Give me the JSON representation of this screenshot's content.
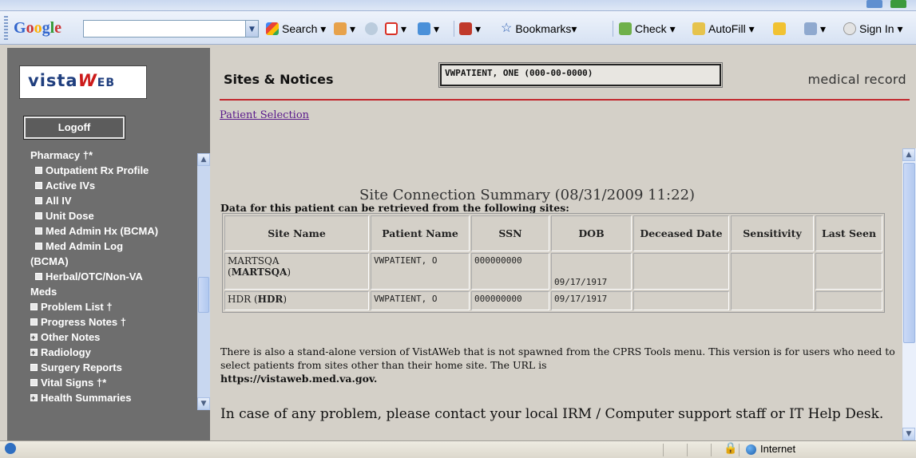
{
  "toolbar": {
    "search_value": "",
    "search_label": "Search",
    "bookmarks_label": "Bookmarks",
    "check_label": "Check",
    "autofill_label": "AutoFill",
    "signin_label": "Sign In"
  },
  "sidebar": {
    "logoff_label": "Logoff",
    "items": [
      {
        "label": "Pharmacy †*",
        "icon": "none"
      },
      {
        "label": "Outpatient Rx Profile",
        "icon": "square"
      },
      {
        "label": "Active IVs",
        "icon": "square"
      },
      {
        "label": "All IV",
        "icon": "square"
      },
      {
        "label": "Unit Dose",
        "icon": "square"
      },
      {
        "label": "Med Admin Hx (BCMA)",
        "icon": "square"
      },
      {
        "label": "Med Admin Log",
        "icon": "square"
      },
      {
        "label": "(BCMA)",
        "icon": "none"
      },
      {
        "label": "Herbal/OTC/Non-VA",
        "icon": "square"
      },
      {
        "label": "Meds",
        "icon": "none"
      },
      {
        "label": "Problem List †",
        "icon": "square"
      },
      {
        "label": "Progress Notes †",
        "icon": "square"
      },
      {
        "label": "Other Notes",
        "icon": "plus"
      },
      {
        "label": "Radiology",
        "icon": "plus"
      },
      {
        "label": "Surgery Reports",
        "icon": "square"
      },
      {
        "label": "Vital Signs †*",
        "icon": "square"
      },
      {
        "label": "Health Summaries",
        "icon": "plus"
      }
    ]
  },
  "header": {
    "title": "Sites & Notices",
    "patient": "VWPATIENT, ONE  (000-00-0000)",
    "right_label": "medical record"
  },
  "main": {
    "patient_selection_link": "Patient Selection",
    "summary_title": "Site Connection Summary (08/31/2009 11:22)",
    "intro_text": "Data for this patient can be retrieved from the following sites:",
    "table": {
      "headers": [
        "Site Name",
        "Patient Name",
        "SSN",
        "DOB",
        "Deceased Date",
        "Sensitivity",
        "Last Seen"
      ],
      "rows": [
        {
          "site": "MARTSQA",
          "site_code": "MARTSQA",
          "patient": "VWPATIENT, O",
          "ssn": "000000000",
          "dob": "09/17/1917",
          "deceased": "",
          "sensitivity": "",
          "last_seen": ""
        },
        {
          "site": "HDR",
          "site_code": "HDR",
          "patient": "VWPATIENT, O",
          "ssn": "000000000",
          "dob": "09/17/1917",
          "deceased": "",
          "sensitivity": "",
          "last_seen": ""
        }
      ]
    },
    "notice_text": "There is also a stand-alone version of VistAWeb that is not spawned from the CPRS Tools menu. This version is for users who need to select patients from sites other than their home site. The URL is",
    "notice_url": "https://vistaweb.med.va.gov.",
    "contact_text": "In case of any problem, please contact your local IRM / Computer support staff or IT Help Desk."
  },
  "statusbar": {
    "zone_label": "Internet"
  }
}
